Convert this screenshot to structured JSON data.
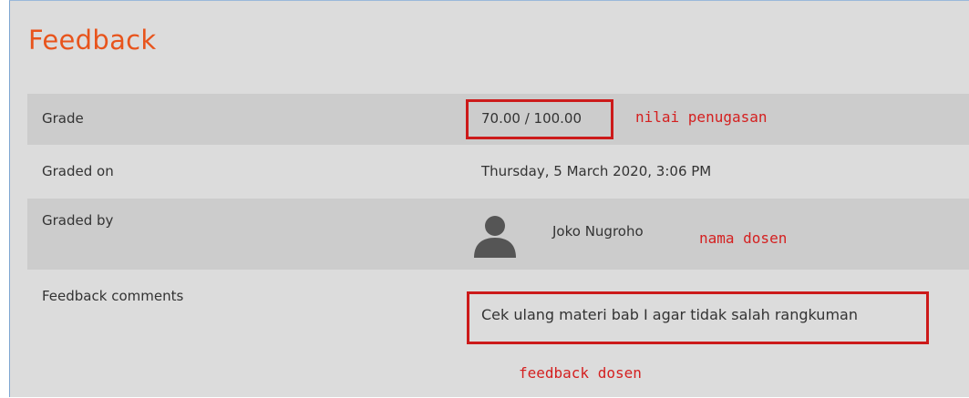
{
  "feedback": {
    "title": "Feedback",
    "rows": {
      "grade": {
        "label": "Grade",
        "value": "70.00 / 100.00"
      },
      "graded_on": {
        "label": "Graded on",
        "value": "Thursday, 5 March 2020, 3:06 PM"
      },
      "graded_by": {
        "label": "Graded by",
        "value": "Joko Nugroho",
        "avatar_icon": "user-avatar-icon"
      },
      "comments": {
        "label": "Feedback comments",
        "value": "Cek ulang materi bab I agar tidak salah rangkuman"
      }
    }
  },
  "annotations": {
    "grade_note": "nilai penugasan",
    "grader_note": "nama dosen",
    "comment_note": "feedback dosen",
    "color": "#cc1a1a"
  },
  "colors": {
    "title": "#e8541c",
    "panel_bg": "#dcdcdc",
    "row_shade": "#cccccc",
    "text": "#333333"
  }
}
